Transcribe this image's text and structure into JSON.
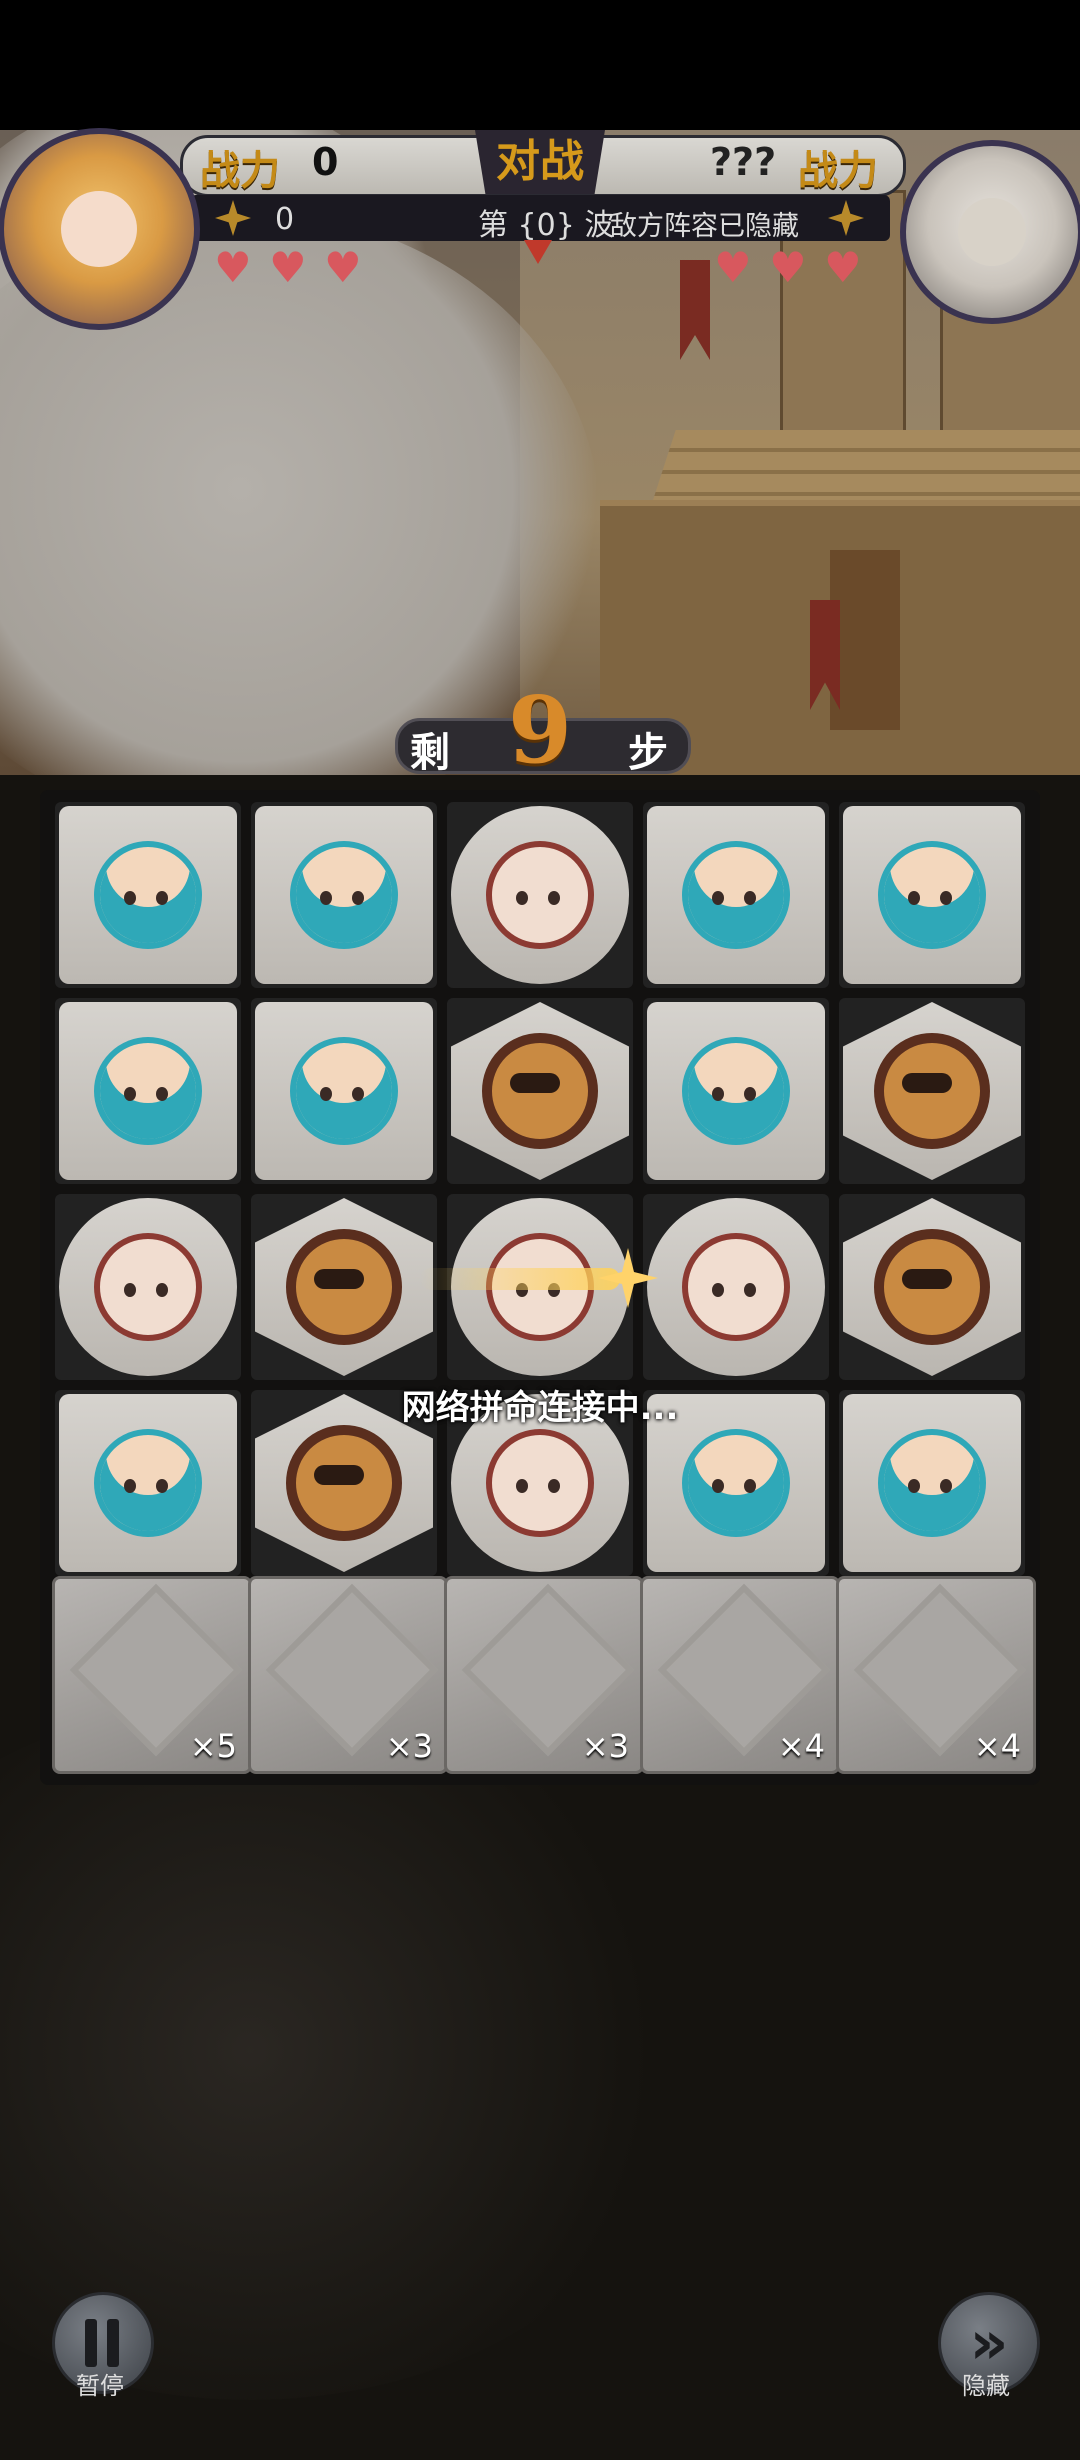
{
  "hud": {
    "power_label_left": "战力",
    "power_label_right": "战力",
    "versus_label": "对战",
    "player_power": "0",
    "enemy_power": "???",
    "player_stars": "0",
    "wave_text": "第 {0} 波",
    "enemy_hidden_text": "敌方阵容已隐藏",
    "player_hearts": 3,
    "enemy_hearts": 3
  },
  "steps": {
    "left_label": "剩",
    "right_label": "步",
    "remaining": "9"
  },
  "board": {
    "rows": [
      [
        {
          "shape": "square",
          "char": "blue"
        },
        {
          "shape": "square",
          "char": "blue"
        },
        {
          "shape": "circle",
          "char": "bunny"
        },
        {
          "shape": "square",
          "char": "blue"
        },
        {
          "shape": "square",
          "char": "blue"
        }
      ],
      [
        {
          "shape": "square",
          "char": "blue"
        },
        {
          "shape": "square",
          "char": "blue"
        },
        {
          "shape": "hexagon",
          "char": "mask"
        },
        {
          "shape": "square",
          "char": "blue"
        },
        {
          "shape": "hexagon",
          "char": "mask"
        }
      ],
      [
        {
          "shape": "circle",
          "char": "bunny"
        },
        {
          "shape": "hexagon",
          "char": "mask"
        },
        {
          "shape": "circle",
          "char": "bunny"
        },
        {
          "shape": "circle",
          "char": "bunny"
        },
        {
          "shape": "hexagon",
          "char": "mask"
        }
      ],
      [
        {
          "shape": "square",
          "char": "blue"
        },
        {
          "shape": "hexagon",
          "char": "mask"
        },
        {
          "shape": "circle",
          "char": "bunny"
        },
        {
          "shape": "square",
          "char": "blue"
        },
        {
          "shape": "square",
          "char": "blue"
        }
      ]
    ],
    "stones": [
      "×5",
      "×3",
      "×3",
      "×4",
      "×4"
    ]
  },
  "loading_text": "网络拼命连接中...",
  "controls": {
    "pause_label": "暂停",
    "hide_label": "隐藏"
  }
}
